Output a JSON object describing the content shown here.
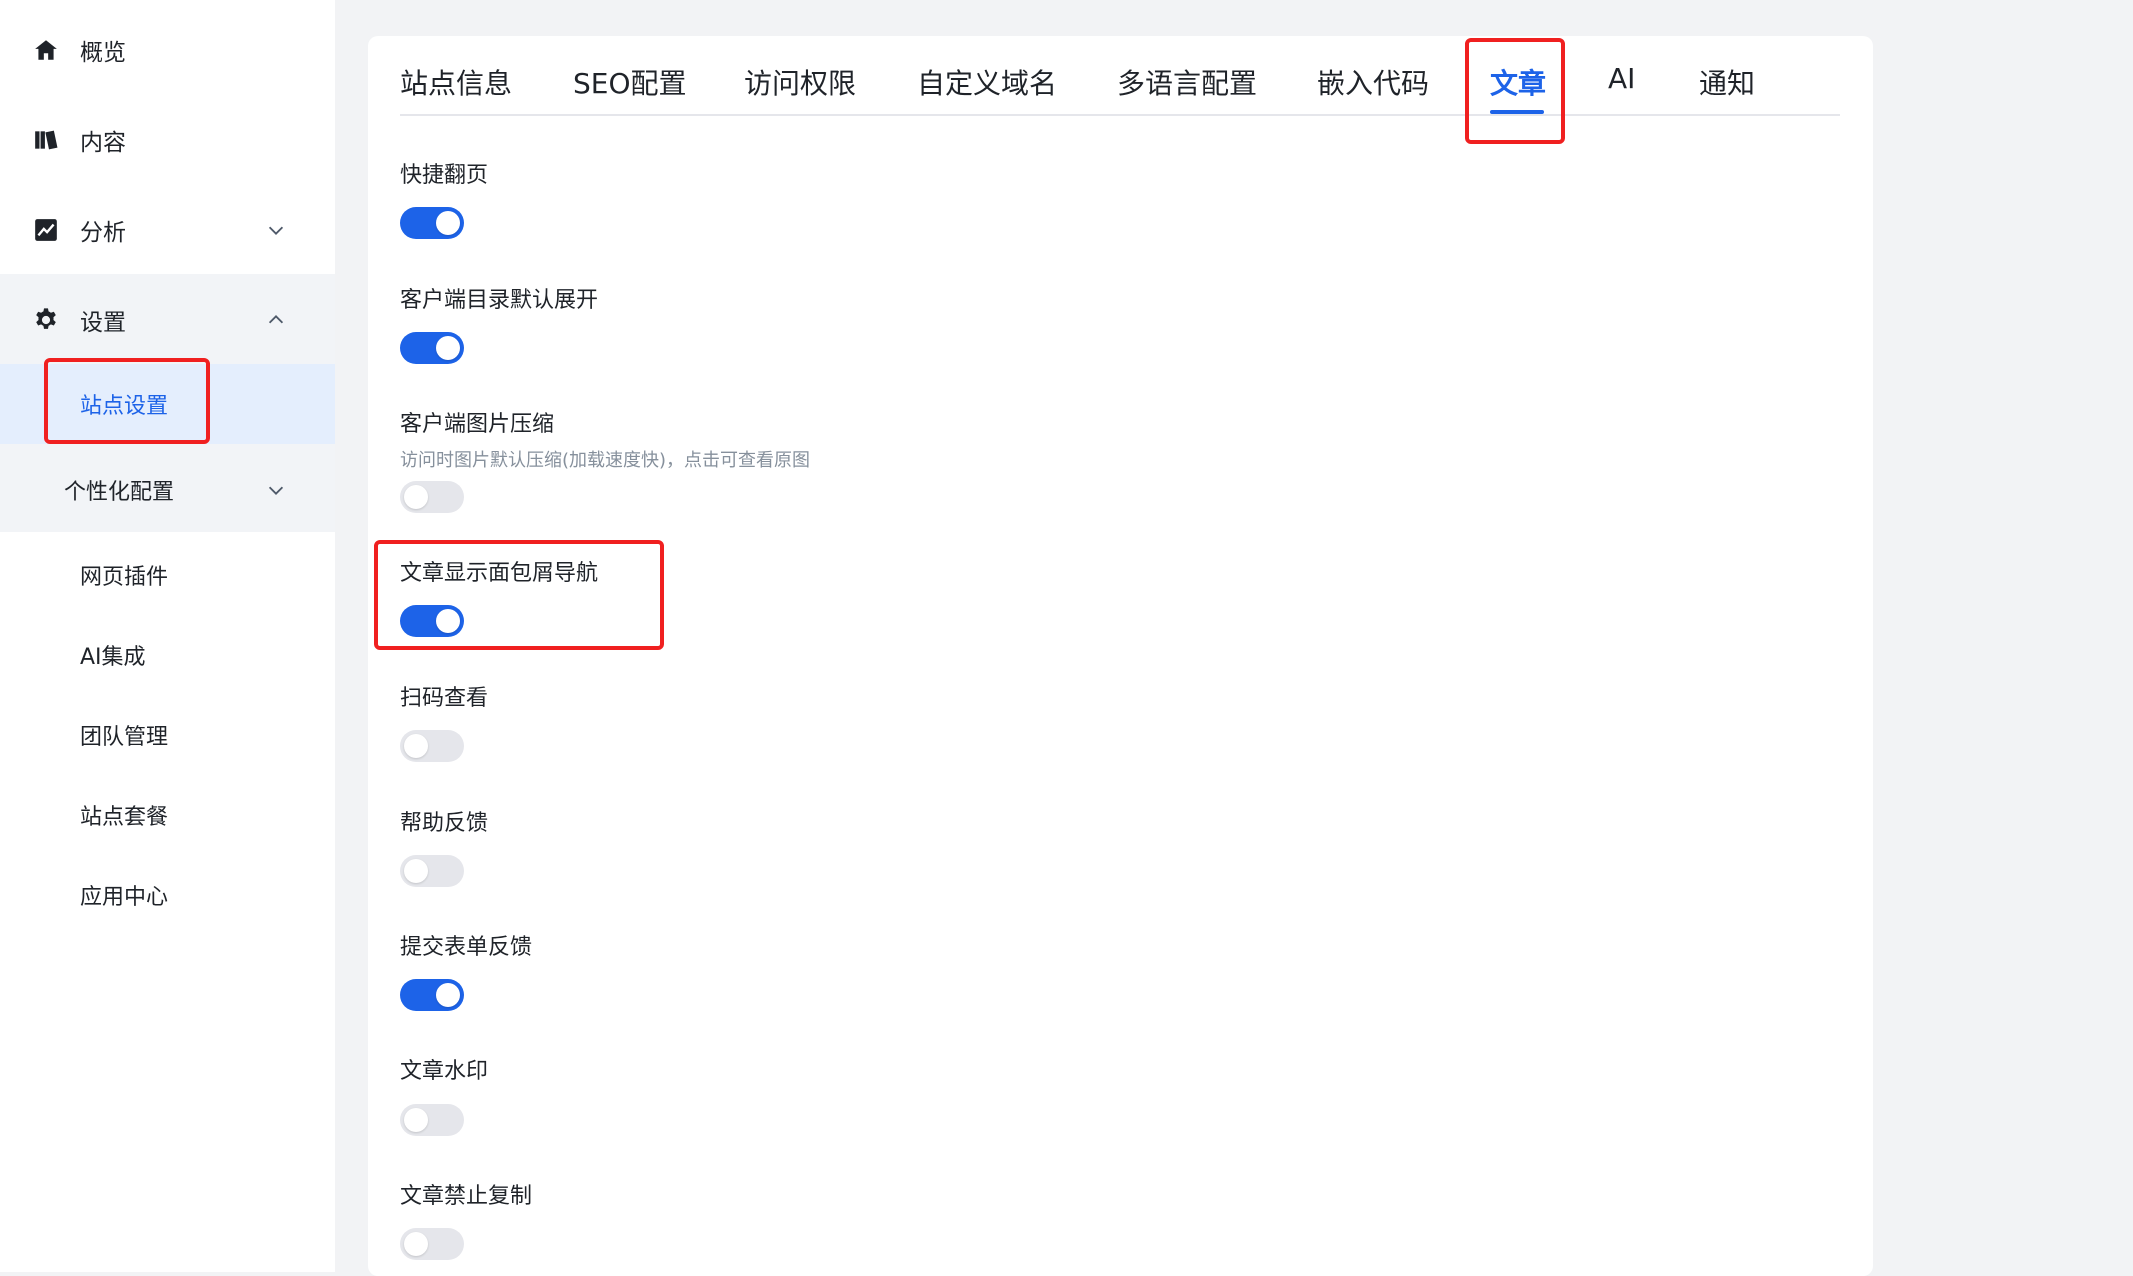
{
  "sidebar": {
    "items": [
      {
        "label": "概览",
        "icon": "home-icon"
      },
      {
        "label": "内容",
        "icon": "books-icon"
      },
      {
        "label": "分析",
        "icon": "chart-line-icon",
        "expanded": false
      },
      {
        "label": "设置",
        "icon": "gear-icon",
        "expanded": true
      }
    ],
    "settings_children": [
      {
        "label": "站点设置",
        "active": true
      },
      {
        "label": "个性化配置",
        "expanded": false
      },
      {
        "label": "网页插件"
      },
      {
        "label": "AI集成"
      },
      {
        "label": "团队管理"
      },
      {
        "label": "站点套餐"
      },
      {
        "label": "应用中心"
      }
    ]
  },
  "tabs": [
    {
      "label": "站点信息"
    },
    {
      "label": "SEO配置"
    },
    {
      "label": "访问权限"
    },
    {
      "label": "自定义域名"
    },
    {
      "label": "多语言配置"
    },
    {
      "label": "嵌入代码"
    },
    {
      "label": "文章",
      "active": true
    },
    {
      "label": "AI"
    },
    {
      "label": "通知"
    }
  ],
  "settings": [
    {
      "label": "快捷翻页",
      "on": true
    },
    {
      "label": "客户端目录默认展开",
      "on": true
    },
    {
      "label": "客户端图片压缩",
      "desc": "访问时图片默认压缩(加载速度快)，点击可查看原图",
      "on": false
    },
    {
      "label": "文章显示面包屑导航",
      "on": true
    },
    {
      "label": "扫码查看",
      "on": false
    },
    {
      "label": "帮助反馈",
      "on": false
    },
    {
      "label": "提交表单反馈",
      "on": true
    },
    {
      "label": "文章水印",
      "on": false
    },
    {
      "label": "文章禁止复制",
      "on": false
    }
  ],
  "colors": {
    "accent": "#1d63e8",
    "highlight_box": "#f02020",
    "toggle_off": "#e5e6eb"
  }
}
